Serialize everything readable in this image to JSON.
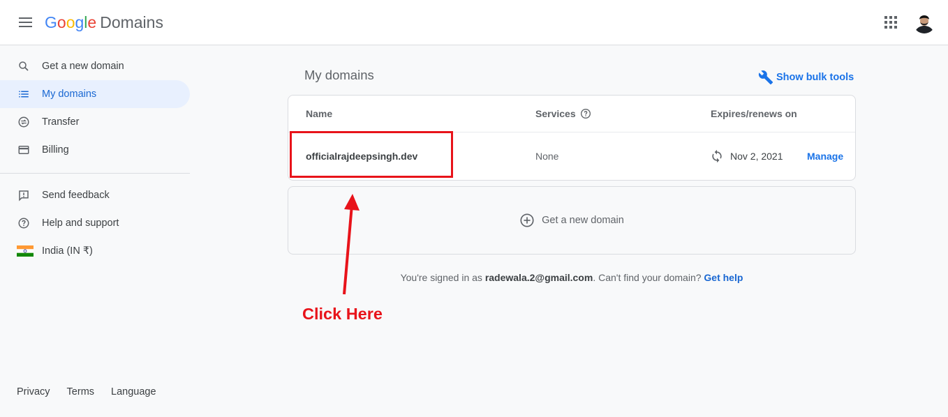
{
  "header": {
    "logo_google": [
      "G",
      "o",
      "o",
      "g",
      "l",
      "e"
    ],
    "logo_google_colors": [
      "#4285f4",
      "#ea4335",
      "#fbbc05",
      "#4285f4",
      "#34a853",
      "#ea4335"
    ],
    "logo_product": "Domains",
    "icons": {
      "menu": "hamburger-menu-icon",
      "apps": "google-apps-grid-icon",
      "avatar": "account-avatar"
    }
  },
  "sidebar": {
    "items": [
      {
        "label": "Get a new domain",
        "icon": "search-icon"
      },
      {
        "label": "My domains",
        "icon": "list-icon",
        "active": true
      },
      {
        "label": "Transfer",
        "icon": "transfer-icon"
      },
      {
        "label": "Billing",
        "icon": "credit-card-icon"
      },
      {
        "label": "Send feedback",
        "icon": "feedback-icon"
      },
      {
        "label": "Help and support",
        "icon": "help-icon"
      },
      {
        "label": "India (IN ₹)",
        "icon": "india-flag-icon"
      }
    ],
    "footer": {
      "privacy": "Privacy",
      "terms": "Terms",
      "language": "Language"
    }
  },
  "main": {
    "title": "My domains",
    "bulk_tools": "Show bulk tools",
    "table": {
      "headers": {
        "name": "Name",
        "services": "Services",
        "expires": "Expires/renews on"
      },
      "rows": [
        {
          "name": "officialrajdeepsingh.dev",
          "services": "None",
          "expires": "Nov 2, 2021",
          "action": "Manage"
        }
      ]
    },
    "get_new_domain": "Get a new domain",
    "signed_in": {
      "prefix": "You're signed in as ",
      "email": "radewala.2@gmail.com",
      "middle": ". Can't find your domain? ",
      "help_link": "Get help"
    }
  },
  "annotation": {
    "text": "Click Here",
    "color": "#e8131a"
  },
  "colors": {
    "accent": "#1a73e8",
    "active_bg": "#e8f0fe",
    "annotation_red": "#e8131a"
  }
}
